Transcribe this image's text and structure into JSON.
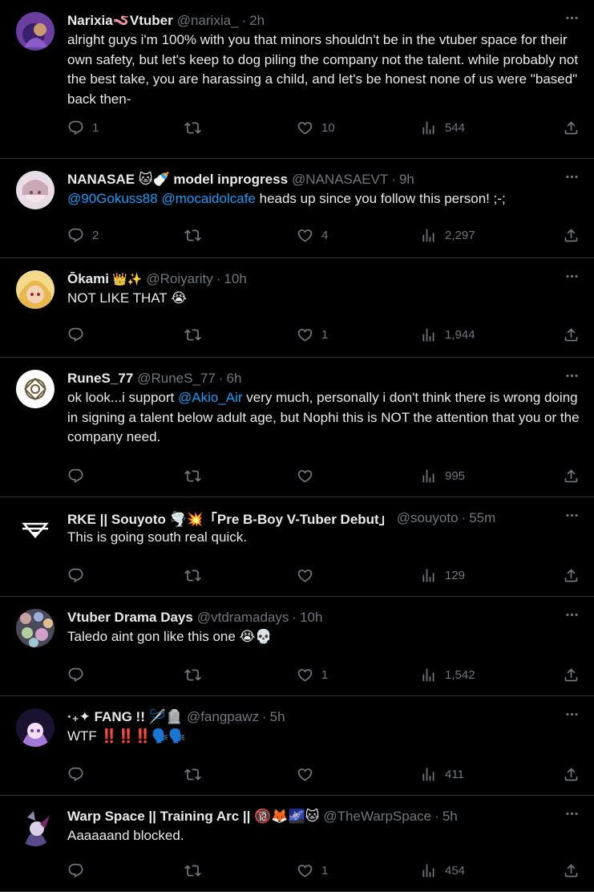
{
  "tweets": [
    {
      "name": "Narixia🪱Vtuber",
      "emoji": "",
      "handle": "@narixia_",
      "time": "2h",
      "text_parts": [
        {
          "t": "alright guys i'm 100% with you that minors shouldn't be in the vtuber space for their own safety, but let's keep to dog piling the company not the talent. while probably not the best take, you are harassing a child, and let's be honest none of us were \"based\" back then-",
          "mention": false
        }
      ],
      "replies": "1",
      "reposts": "",
      "likes": "10",
      "views": "544"
    },
    {
      "name": "NANASAE 🐱🍼 model inprogress",
      "emoji": "",
      "handle": "@NANASAEVT",
      "time": "9h",
      "text_parts": [
        {
          "t": "@90Gokuss88",
          "mention": true
        },
        {
          "t": " ",
          "mention": false
        },
        {
          "t": "@mocaidolcafe",
          "mention": true
        },
        {
          "t": " heads up since you follow this person! ;-;",
          "mention": false
        }
      ],
      "replies": "2",
      "reposts": "",
      "likes": "4",
      "views": "2,297"
    },
    {
      "name": "Ōkami",
      "emoji": "👑✨",
      "handle": "@Roiyarity",
      "time": "10h",
      "text_parts": [
        {
          "t": "NOT LIKE THAT 😭",
          "mention": false
        }
      ],
      "replies": "",
      "reposts": "",
      "likes": "1",
      "views": "1,944"
    },
    {
      "name": "RuneS_77",
      "emoji": "",
      "handle": "@RuneS_77",
      "time": "6h",
      "text_parts": [
        {
          "t": "ok look...i support ",
          "mention": false
        },
        {
          "t": "@Akio_Air",
          "mention": true
        },
        {
          "t": " very much, personally i don't think there is wrong doing in signing a talent below adult age, but Nophi this is NOT the attention that you or the company need.",
          "mention": false
        }
      ],
      "replies": "",
      "reposts": "",
      "likes": "",
      "views": "995"
    },
    {
      "name": "RKE || Souyoto 🌪️💥「Pre B-Boy V-Tuber Debut」",
      "emoji": "",
      "handle": "@souyoto",
      "time": "55m",
      "text_parts": [
        {
          "t": "This is going south real quick.",
          "mention": false
        }
      ],
      "replies": "",
      "reposts": "",
      "likes": "",
      "views": "129"
    },
    {
      "name": "Vtuber Drama Days",
      "emoji": "",
      "handle": "@vtdramadays",
      "time": "10h",
      "text_parts": [
        {
          "t": "Taledo aint gon like this one 😭💀",
          "mention": false
        }
      ],
      "replies": "",
      "reposts": "",
      "likes": "1",
      "views": "1,542"
    },
    {
      "name": "·₊✦ FANG !! 🪡🪦",
      "emoji": "",
      "handle": "@fangpawz",
      "time": "5h",
      "text_parts": [
        {
          "t": "WTF ‼️‼️‼️🗣️🗣️",
          "mention": false
        }
      ],
      "replies": "",
      "reposts": "",
      "likes": "",
      "views": "411"
    },
    {
      "name": "Warp Space || Training Arc || 🔞🦊🌌🐱",
      "emoji": "",
      "handle": "@TheWarpSpace",
      "time": "5h",
      "text_parts": [
        {
          "t": "Aaaaaand blocked.",
          "mention": false
        }
      ],
      "replies": "",
      "reposts": "",
      "likes": "1",
      "views": "454"
    }
  ],
  "colors": {
    "background": "#000000",
    "text": "#e7e9ea",
    "muted": "#71767b",
    "mention": "#1d9bf0",
    "divider": "#2f3336"
  },
  "icons": {
    "reply": "reply-icon",
    "repost": "repost-icon",
    "like": "heart-icon",
    "views": "views-icon",
    "share": "share-icon",
    "more": "more-icon"
  }
}
